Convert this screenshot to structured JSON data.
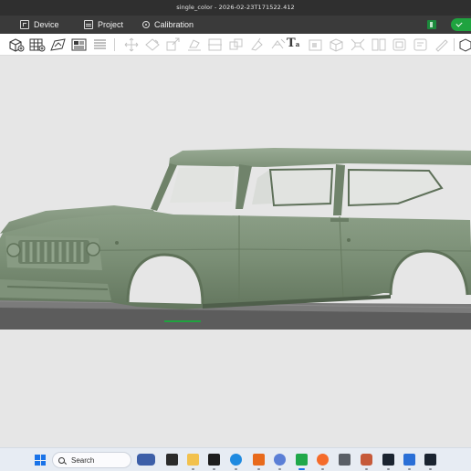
{
  "window": {
    "title": "single_color - 2026-02-23T171522.412"
  },
  "menubar": {
    "items": [
      {
        "label": "Device",
        "icon": "device-icon"
      },
      {
        "label": "Project",
        "icon": "project-icon"
      },
      {
        "label": "Calibration",
        "icon": "calibration-icon"
      }
    ],
    "slice_icon": "slice-plate-icon",
    "slice_button_icon": "check-icon"
  },
  "toolbar": {
    "tools": [
      "add-object-icon",
      "arrange-grid-icon",
      "auto-orient-icon",
      "plate-icon",
      "layers-icon",
      "move-icon",
      "rotate-icon",
      "scale-icon",
      "lay-on-face-icon",
      "cut-icon",
      "paint-supports-icon",
      "seam-painting-icon",
      "text-tool-icon",
      "emboss-icon",
      "measure-icon",
      "assembly-icon",
      "split-objects-icon",
      "split-parts-icon",
      "variable-layer-icon",
      "brim-ears-icon",
      "view-icon"
    ],
    "text_tool_label": "T",
    "text_tool_sub": "a"
  },
  "viewport": {
    "model": "3d-model-truck-body",
    "model_color": "#7d9178",
    "build_plate_color": "#5a5a5a",
    "background_color": "#e6e6e6"
  },
  "taskbar": {
    "search_placeholder": "Search",
    "apps": [
      "widgets-icon",
      "task-view-icon",
      "file-explorer-icon",
      "terminal-icon",
      "edge-icon",
      "fusion-icon",
      "settings-icon",
      "bambu-studio-icon",
      "firefox-icon",
      "calculator-icon",
      "app-icon",
      "app-icon",
      "photos-icon",
      "app-icon"
    ],
    "accent": "#1a73e8"
  }
}
